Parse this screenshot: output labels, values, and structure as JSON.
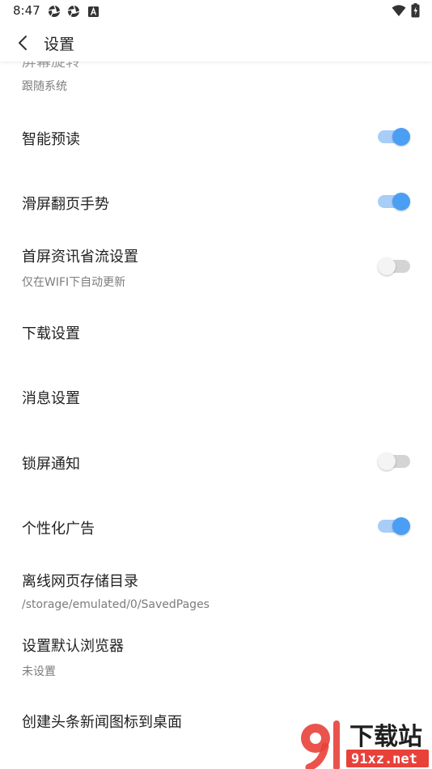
{
  "status_bar": {
    "time": "8:47",
    "icons": [
      "app-icon",
      "app-icon",
      "a-icon"
    ],
    "right_icons": [
      "wifi-icon",
      "battery-icon"
    ]
  },
  "header": {
    "title": "设置",
    "back_icon": "chevron-left-icon"
  },
  "settings": {
    "screen_rotation": {
      "title": "屏幕旋转",
      "subtitle": "跟随系统"
    },
    "smart_preread": {
      "title": "智能预读",
      "enabled": true
    },
    "swipe_gesture": {
      "title": "滑屏翻页手势",
      "enabled": true
    },
    "homepage_data_saver": {
      "title": "首屏资讯省流设置",
      "subtitle": "仅在WIFI下自动更新",
      "enabled": false
    },
    "download_settings": {
      "title": "下载设置"
    },
    "message_settings": {
      "title": "消息设置"
    },
    "lockscreen_notification": {
      "title": "锁屏通知",
      "enabled": false
    },
    "personalized_ads": {
      "title": "个性化广告",
      "enabled": true
    },
    "offline_dir": {
      "title": "离线网页存储目录",
      "subtitle": "/storage/emulated/0/SavedPages"
    },
    "default_browser": {
      "title": "设置默认浏览器",
      "subtitle": "未设置"
    },
    "desktop_shortcut": {
      "title": "创建头条新闻图标到桌面"
    }
  },
  "watermark": {
    "text_main": "下载站",
    "text_sub": "91xz.net"
  },
  "colors": {
    "toggle_on": "#4a9ff5",
    "toggle_on_track": "#a8cdf6",
    "toggle_off_track": "#d4d4d4"
  }
}
